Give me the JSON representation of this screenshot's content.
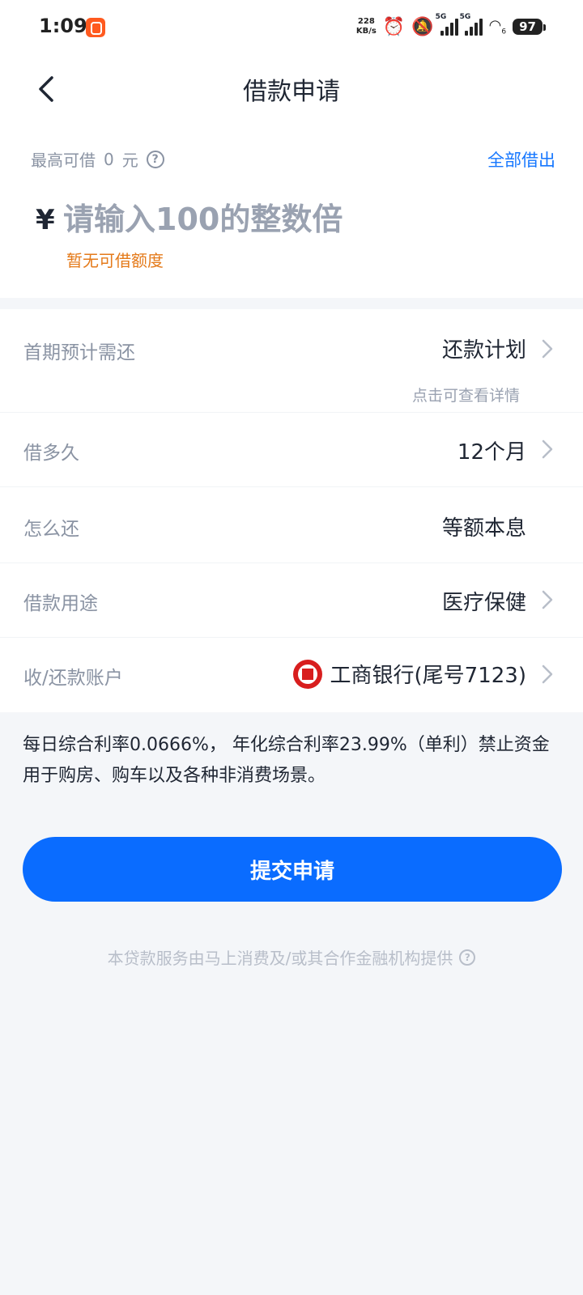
{
  "status_bar": {
    "time": "1:09",
    "net_speed_value": "228",
    "net_speed_unit": "KB/s",
    "network_1": "5G",
    "network_2": "5G",
    "wifi_sub": "6",
    "battery": "97"
  },
  "header": {
    "title": "借款申请"
  },
  "amount": {
    "max_label": "最高可借",
    "max_value": "0",
    "max_unit": "元",
    "borrow_all": "全部借出",
    "currency_symbol": "¥",
    "input_placeholder": "请输入100的整数倍",
    "quota_hint": "暂无可借额度"
  },
  "rows": {
    "first_payment": {
      "label": "首期预计需还",
      "value": "还款计划",
      "sub": "点击可查看详情"
    },
    "term": {
      "label": "借多久",
      "value": "12个月"
    },
    "repay_method": {
      "label": "怎么还",
      "value": "等额本息"
    },
    "purpose": {
      "label": "借款用途",
      "value": "医疗保健"
    },
    "account": {
      "label": "收/还款账户",
      "value": "工商银行(尾号7123)"
    }
  },
  "notice": "每日综合利率0.0666%， 年化综合利率23.99%（单利）禁止资金用于购房、购车以及各种非消费场景。",
  "submit_label": "提交申请",
  "footer": "本贷款服务由马上消费及/或其合作金融机构提供",
  "colors": {
    "primary": "#0a6cff",
    "link": "#1677ff",
    "warning": "#e47a1a",
    "bank_red": "#d81e1e"
  }
}
